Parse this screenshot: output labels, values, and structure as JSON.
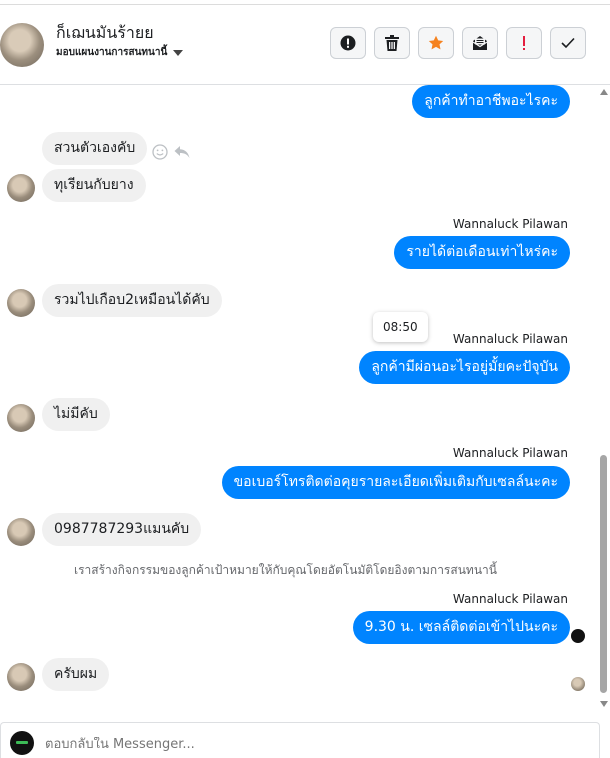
{
  "header": {
    "contact_name": "ก็เฌนมันร้ายย",
    "stage_label": "มอบแผนงานการสนทนานี้",
    "actions": [
      {
        "icon": "alert-circle-icon"
      },
      {
        "icon": "trash-icon"
      },
      {
        "icon": "star-icon",
        "color": "#f5821f"
      },
      {
        "icon": "mark-unread-icon"
      },
      {
        "icon": "exclamation-icon",
        "color": "#e41e3f"
      },
      {
        "icon": "check-icon"
      }
    ]
  },
  "messages": {
    "m1": "ลูกค้าทำอาชีพอะไรคะ",
    "m2": "สวนตัวเองคับ",
    "m3": "ทุเรียนกับยาง",
    "m4_sender": "Wannaluck Pilawan",
    "m4": "รายได้ต่อเดือนเท่าไหร่คะ",
    "m5": "รวมไปเกือบ2เหมือนได้คับ",
    "m6_tooltip": "08:50",
    "m6_sender": "Wannaluck Pilawan",
    "m6": "ลูกค้ามีผ่อนอะไรอยู่มั้ยคะปัจุบัน",
    "m7": "ไม่มีคับ",
    "m8_sender": "Wannaluck Pilawan",
    "m8": "ขอเบอร์โทรติดต่อคุยรายละเอียดเพิ่มเติมกับเซลล์นะคะ",
    "m9": "0987787293แมนคับ",
    "system_note": "เราสร้างกิจกรรมของลูกค้าเป้าหมายให้กับคุณโดยอัตโนมัติโดยอิงตามการสนทนานี้",
    "m10_sender": "Wannaluck Pilawan",
    "m10": "9.30 น.  เซลล์ติดต่อเข้าไปนะคะ",
    "m11": "ครับผม"
  },
  "composer": {
    "placeholder": "ตอบกลับใน Messenger..."
  },
  "colors": {
    "outgoing_bubble": "#0084ff",
    "incoming_bubble": "#f0f0f0"
  }
}
